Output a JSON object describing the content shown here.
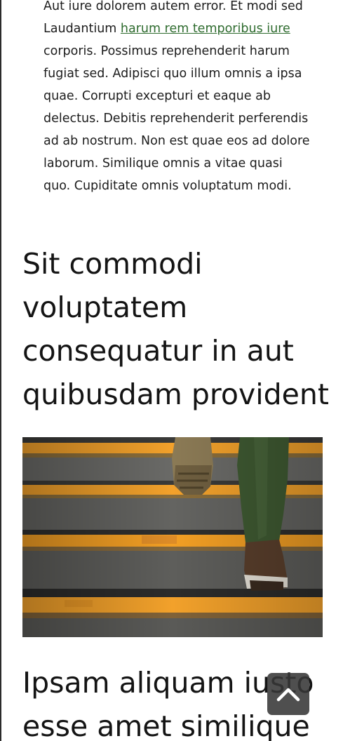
{
  "article": {
    "paragraph_before_link": "Aut iure dolorem autem error. Et modi sed Laudantium ",
    "paragraph_link": "harum rem temporibus iure",
    "paragraph_after_link": " corporis. Possimus reprehenderit harum fugiat sed. Adipisci quo illum omnis a ipsa quae. Corrupti excepturi et eaque ab delectus. Debitis reprehenderit perferendis ad ab nostrum. Non est quae eos ad dolore laborum. Similique omnis a vitae quasi quo. Cupiditate omnis voluptatum modi.",
    "heading_1": "Sit commodi voluptatem consequatur in aut quibusdam provident",
    "heading_2": "Ipsam aliquam iusto esse amet similique"
  },
  "colors": {
    "link": "#2e6b2e",
    "stair_stripe": "#f2a12b",
    "stair_concrete": "#5e5e5c",
    "scroll_button_bg": "#373737"
  },
  "icons": {
    "scroll_top": "chevron-up-icon"
  }
}
